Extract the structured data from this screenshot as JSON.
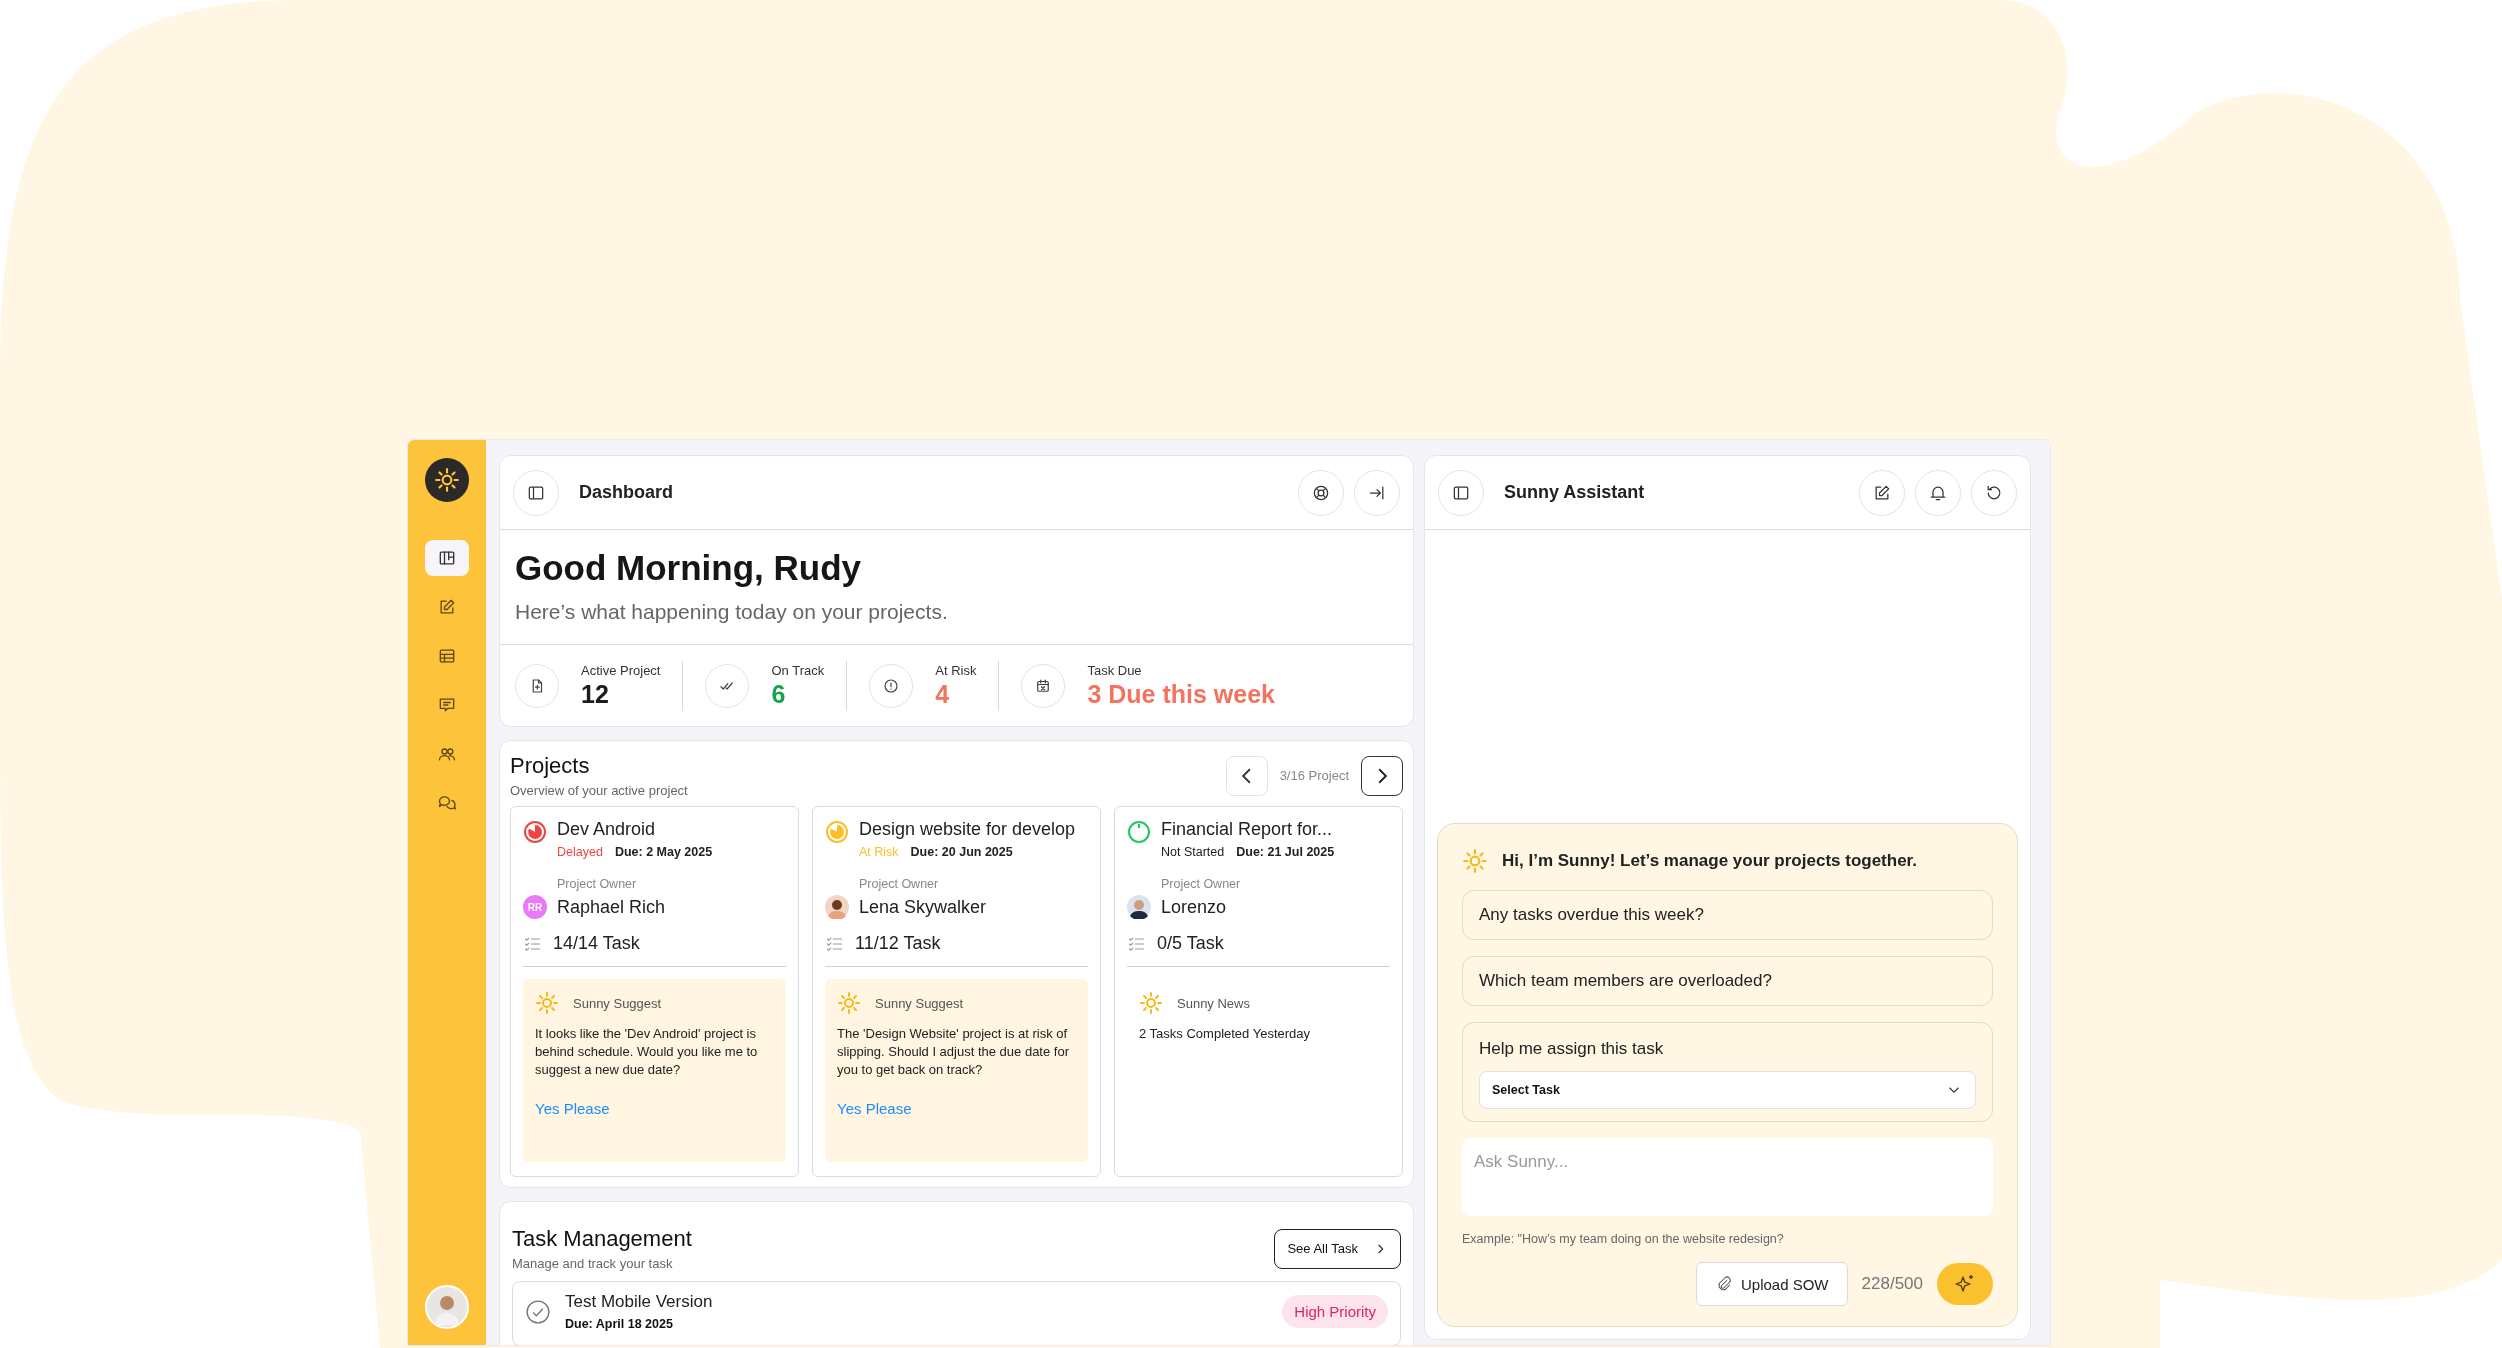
{
  "sidebar": {
    "nav_items": [
      {
        "kind": "board",
        "selected": true
      },
      {
        "kind": "edit",
        "selected": false
      },
      {
        "kind": "table",
        "selected": false
      },
      {
        "kind": "message",
        "selected": false
      },
      {
        "kind": "users",
        "selected": false
      },
      {
        "kind": "chat",
        "selected": false
      }
    ]
  },
  "dashboard": {
    "title": "Dashboard",
    "greeting": "Good Morning, Rudy",
    "subtitle": "Here’s what happening today on your projects.",
    "stats": [
      {
        "kind": "file",
        "label": "Active Project",
        "value": "12",
        "color": "#1c1c1c"
      },
      {
        "kind": "check",
        "label": "On Track",
        "value": "6",
        "color": "#16a34a"
      },
      {
        "kind": "alert",
        "label": "At Risk",
        "value": "4",
        "color": "#f4735f"
      },
      {
        "kind": "calendar",
        "label": "Task Due",
        "value": "3 Due this week",
        "color": "#f4735f"
      }
    ]
  },
  "projects": {
    "title": "Projects",
    "subtitle": "Overview of your active project",
    "pager": "3/16 Project",
    "cards": [
      {
        "name": "Dev Android",
        "color": "#ef4444",
        "status": {
          "text": "Delayed",
          "color": "#ef4444"
        },
        "due": "Due: 2 May 2025",
        "owner_label": "Project Owner",
        "owner": {
          "name": "Raphael Rich",
          "kind": "initials",
          "initials": "RR"
        },
        "tasks": "14/14 Task",
        "note": {
          "kind": "suggest",
          "title": "Sunny Suggest",
          "text": "It looks like the 'Dev Android' project is behind schedule. Would you like me to suggest a new due date?",
          "action": "Yes Please"
        }
      },
      {
        "name": "Design website for develop",
        "color": "#fbbf24",
        "status": {
          "text": "At Risk",
          "color": "#fbbf24"
        },
        "due": "Due: 20 Jun 2025",
        "owner_label": "Project Owner",
        "owner": {
          "name": "Lena Skywalker",
          "kind": "photo"
        },
        "tasks": "11/12 Task",
        "note": {
          "kind": "suggest",
          "title": "Sunny Suggest",
          "text": "The 'Design Website' project is at risk of slipping. Should I adjust the due date for you to get back on track?",
          "action": "Yes Please"
        }
      },
      {
        "name": "Financial Report for...",
        "color": "#22c55e",
        "status": {
          "text": "Not Started",
          "color": "#1c1c1c"
        },
        "due": "Due: 21 Jul 2025",
        "owner_label": "Project Owner",
        "owner": {
          "name": "Lorenzo",
          "kind": "photo"
        },
        "tasks": "0/5 Task",
        "note": {
          "kind": "news",
          "title": "Sunny News",
          "text": "2 Tasks Completed Yesterday"
        }
      }
    ]
  },
  "task_management": {
    "title": "Task Management",
    "subtitle": "Manage and track your task",
    "button": "See All Task",
    "tasks": [
      {
        "name": "Test Mobile Version",
        "due": "Due: April 18 2025",
        "priority": "High Priority"
      }
    ]
  },
  "assistant": {
    "title": "Sunny Assistant",
    "greeting": "Hi, I’m Sunny! Let’s manage your projects together.",
    "prompts": [
      "Any tasks overdue this week?",
      "Which team members are overloaded?"
    ],
    "assign": {
      "label": "Help me assign this task",
      "select": "Select Task"
    },
    "input": {
      "placeholder": "Ask Sunny..."
    },
    "example": "Example: \"How’s my team doing on the website redesign?",
    "upload": "Upload SOW",
    "count": "228/500"
  }
}
